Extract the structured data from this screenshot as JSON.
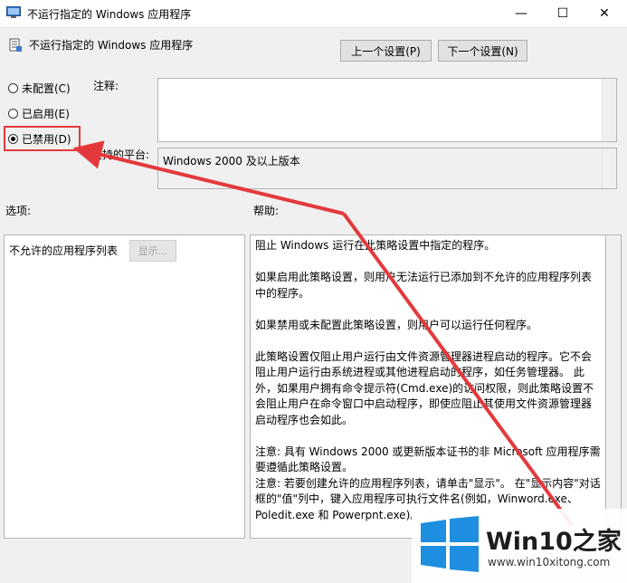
{
  "window": {
    "title": "不运行指定的 Windows 应用程序",
    "minimize_glyph": "—",
    "maximize_glyph": "☐",
    "close_glyph": "✕"
  },
  "header": {
    "title": "不运行指定的 Windows 应用程序",
    "prev_button": "上一个设置(P)",
    "next_button": "下一个设置(N)"
  },
  "state": {
    "options": [
      {
        "label": "未配置(C)",
        "checked": false
      },
      {
        "label": "已启用(E)",
        "checked": false
      },
      {
        "label": "已禁用(D)",
        "checked": true
      }
    ]
  },
  "labels": {
    "comment": "注释:",
    "platform": "支持的平台:",
    "options": "选项:",
    "help": "帮助:"
  },
  "platform": {
    "value": "Windows 2000 及以上版本"
  },
  "options_panel": {
    "label": "不允许的应用程序列表",
    "show_button": "显示..."
  },
  "help": {
    "p1": "阻止 Windows 运行在此策略设置中指定的程序。",
    "p2": "如果启用此策略设置，则用户无法运行已添加到不允许的应用程序列表中的程序。",
    "p3": "如果禁用或未配置此策略设置，则用户可以运行任何程序。",
    "p4": "此策略设置仅阻止用户运行由文件资源管理器进程启动的程序。它不会阻止用户运行由系统进程或其他进程启动的程序，如任务管理器。 此外，如果用户拥有命令提示符(Cmd.exe)的访问权限，则此策略设置不会阻止用户在命令窗口中启动程序，即使应阻止其使用文件资源管理器启动程序也会如此。",
    "p5": "注意: 具有 Windows 2000 或更新版本证书的非 Microsoft 应用程序需要遵循此策略设置。",
    "p6": "注意: 若要创建允许的应用程序列表，请单击\"显示\"。 在\"显示内容\"对话框的\"值\"列中，键入应用程序可执行文件名(例如，Winword.exe、Poledit.exe 和 Powerpnt.exe)。"
  },
  "watermark": {
    "brand": "Win10之家",
    "url": "www.win10xitong.com"
  },
  "colors": {
    "highlight": "#e4393c",
    "window_bg": "#f0f0f0",
    "button_bg": "#e1e1e1",
    "logo_blue": "#1e8fe0"
  }
}
